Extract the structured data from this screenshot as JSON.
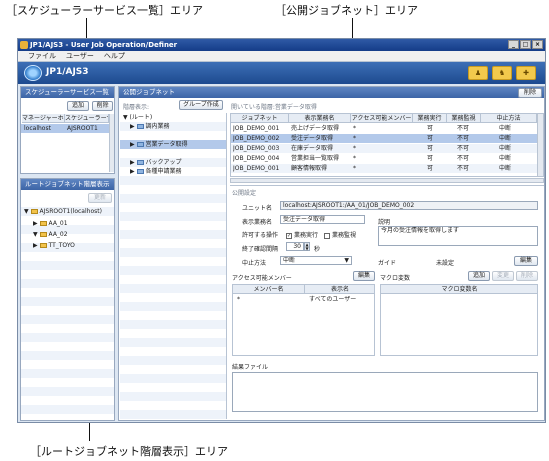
{
  "callouts": {
    "scheduler_list_area": "［スケジューラーサービス一覧］エリア",
    "public_jobnet_area": "［公開ジョブネット］エリア",
    "root_jobnet_area": "［ルートジョブネット階層表示］エリア"
  },
  "window": {
    "title": "JP1/AJS3 - User Job Operation/Definer",
    "controls": [
      "_",
      "□",
      "×"
    ]
  },
  "menu": [
    "ファイル",
    "ユーザー",
    "ヘルプ"
  ],
  "banner": {
    "logo": "JP1/AJS3",
    "tools": [
      {
        "icon": "person-icon",
        "glyph": "♟"
      },
      {
        "icon": "group-icon",
        "glyph": "♞"
      },
      {
        "icon": "user-add-icon",
        "glyph": "✚"
      }
    ]
  },
  "scheduler": {
    "header": "スケジューラーサービス一覧",
    "add_label": "追加",
    "delete_label": "削除",
    "columns": [
      "マネージャーホスト",
      "スケジューラーサービス"
    ],
    "rows": [
      [
        "localhost",
        "AJSROOT1"
      ]
    ]
  },
  "root_tree": {
    "header": "ルートジョブネット階層表示",
    "button_label": "更新",
    "items": [
      {
        "label": "AJSROOT1(localhost)",
        "expander": "▼",
        "level": 0
      },
      {
        "label": "AA_01",
        "expander": "▶",
        "level": 1
      },
      {
        "label": "AA_02",
        "expander": "▼",
        "level": 1
      },
      {
        "label": "TT_TOYO",
        "expander": "▶",
        "level": 1
      }
    ]
  },
  "public": {
    "header": "公開ジョブネット",
    "delete_label": "削除",
    "hierarchy_label": "階層表示:",
    "group_button": "グループ作成",
    "open_hierarchy": "開いている階層:営業データ取得",
    "tree_items": [
      {
        "label": "(ルート)",
        "expander": "▼",
        "level": 0
      },
      {
        "label": "調内業務",
        "expander": "▶",
        "level": 1
      },
      {
        "label": "営業データ取得",
        "expander": "▶",
        "level": 1
      },
      {
        "label": "バックアップ",
        "expander": "▶",
        "level": 1
      },
      {
        "label": "各種申請業務",
        "expander": "▶",
        "level": 1
      }
    ],
    "columns": [
      "ジョブネット",
      "表示業務名",
      "アクセス可能メンバー",
      "業務実行",
      "業務監視",
      "中止方法"
    ],
    "rows": [
      [
        "JOB_DEMO_001",
        "売上げデータ取得",
        "*",
        "可",
        "不可",
        "中断"
      ],
      [
        "JOB_DEMO_002",
        "受注データ取得",
        "*",
        "可",
        "不可",
        "中断"
      ],
      [
        "JOB_DEMO_003",
        "在庫データ取得",
        "*",
        "可",
        "不可",
        "中断"
      ],
      [
        "JOB_DEMO_004",
        "営業担当一覧取得",
        "*",
        "可",
        "不可",
        "中断"
      ],
      [
        "JOB_DEMO_001",
        "顧客情報取得",
        "*",
        "可",
        "不可",
        "中断"
      ]
    ]
  },
  "settings": {
    "header": "公開設定",
    "unit_name_label": "ユニット名",
    "unit_name_value": "localhost:AJSROOT1:/AA_01/JOB_DEMO_002",
    "display_name_label": "表示業務名",
    "display_name_value": "受注データ取得",
    "description_label": "説明",
    "description_value": "今月の受注情報を取得します",
    "allowed_ops_label": "許可する操作",
    "op_execute_label": "業務実行",
    "op_execute_checked": true,
    "op_monitor_label": "業務監視",
    "op_monitor_checked": false,
    "confirm_interval_label": "終了確認間隔",
    "confirm_interval_value": "30",
    "confirm_interval_unit": "秒",
    "stop_method_label": "中止方法",
    "stop_method_value": "中断",
    "guide_label": "ガイド",
    "guide_value": "未設定",
    "guide_edit_label": "編集",
    "access_members_label": "アクセス可能メンバー",
    "access_edit_label": "編集",
    "access_columns": [
      "メンバー名",
      "表示名"
    ],
    "access_rows": [
      [
        "*",
        "すべてのユーザー"
      ]
    ],
    "macro_label": "マクロ変数",
    "macro_add_label": "追加",
    "macro_change_label": "変更",
    "macro_delete_label": "削除",
    "macro_columns": [
      "マクロ変数名"
    ],
    "result_file_label": "結果ファイル"
  },
  "colors": {
    "header_blue": "#3c64a6",
    "selected_row": "#b3c9ea",
    "banner": "#1d4a8f"
  }
}
